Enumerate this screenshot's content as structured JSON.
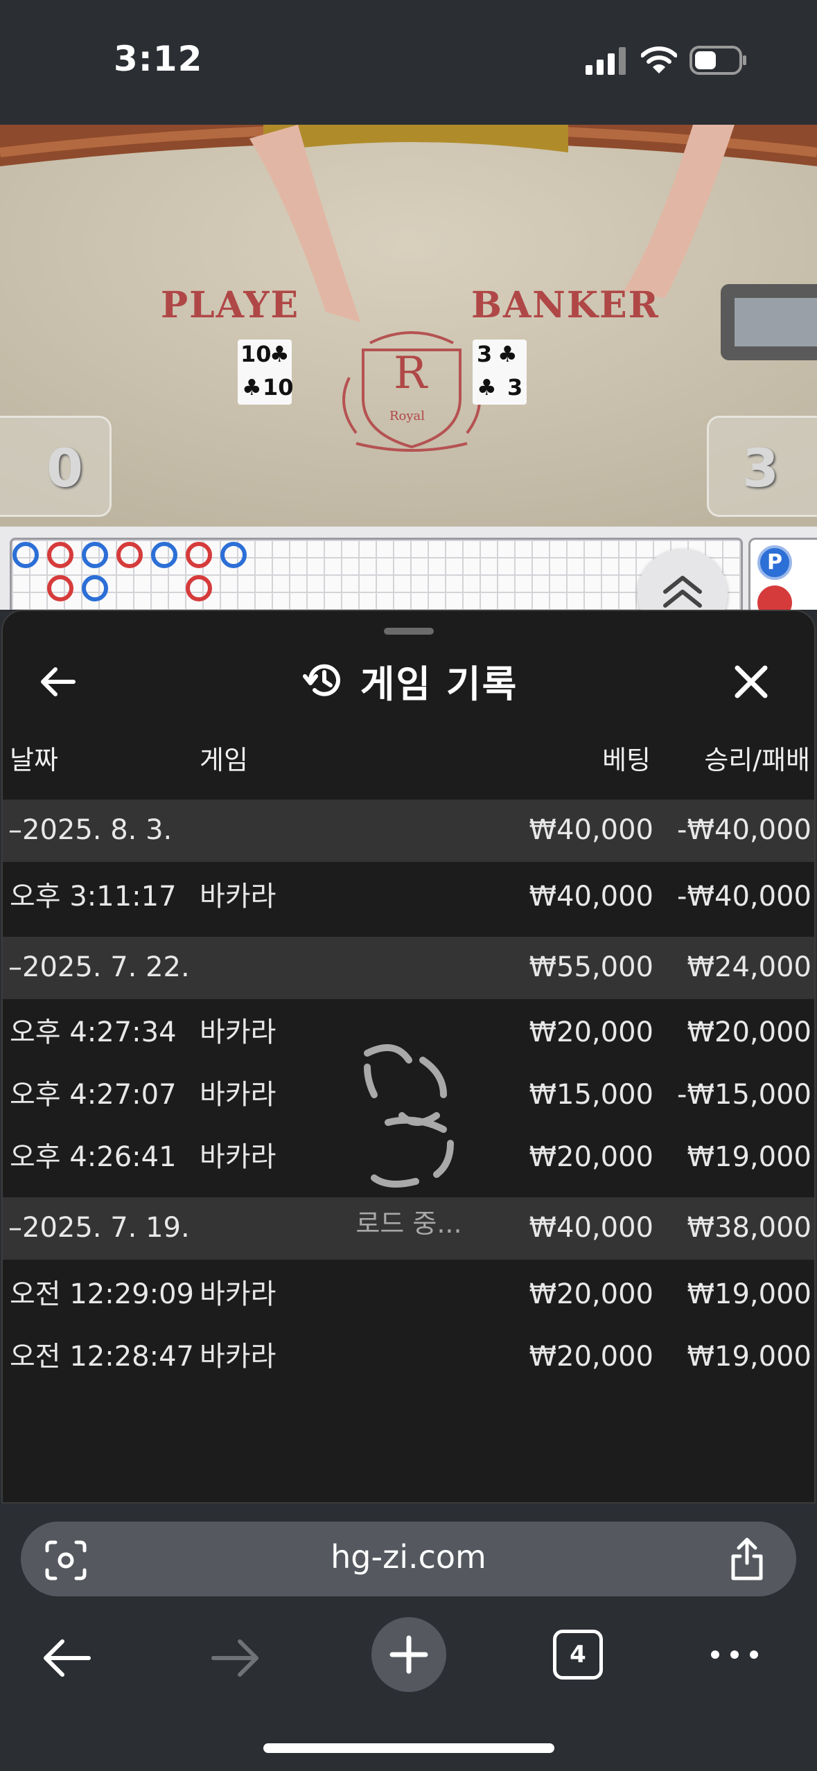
{
  "status_bar": {
    "time": "3:12"
  },
  "video": {
    "player_label": "PLAYE",
    "banker_label": "BANKER",
    "player_card_rank": "10",
    "player_card_suit": "♣",
    "banker_card_rank": "3",
    "banker_card_suit": "♣",
    "logo_letter": "R",
    "logo_text": "Royal",
    "player_score": "0",
    "banker_score": "3"
  },
  "roadmap": {
    "side_label": "P",
    "colors": {
      "player": "#2c6fd6",
      "banker": "#d63b3b"
    }
  },
  "history": {
    "title": "게임 기록",
    "headers": {
      "date": "날짜",
      "game": "게임",
      "bet": "베팅",
      "win_loss": "승리/패배"
    },
    "groups": [
      {
        "date": "–2025. 8. 3.",
        "bet": "₩40,000",
        "win_loss": "-₩40,000",
        "rows": [
          {
            "time": "오후 3:11:17",
            "game": "바카라",
            "bet": "₩40,000",
            "win_loss": "-₩40,000"
          }
        ]
      },
      {
        "date": "–2025. 7. 22.",
        "bet": "₩55,000",
        "win_loss": "₩24,000",
        "rows": [
          {
            "time": "오후 4:27:34",
            "game": "바카라",
            "bet": "₩20,000",
            "win_loss": "₩20,000"
          },
          {
            "time": "오후 4:27:07",
            "game": "바카라",
            "bet": "₩15,000",
            "win_loss": "-₩15,000"
          },
          {
            "time": "오후 4:26:41",
            "game": "바카라",
            "bet": "₩20,000",
            "win_loss": "₩19,000"
          }
        ]
      },
      {
        "date": "–2025. 7. 19.",
        "bet": "₩40,000",
        "win_loss": "₩38,000",
        "rows": [
          {
            "time": "오전 12:29:09",
            "game": "바카라",
            "bet": "₩20,000",
            "win_loss": "₩19,000"
          },
          {
            "time": "오전 12:28:47",
            "game": "바카라",
            "bet": "₩20,000",
            "win_loss": "₩19,000"
          }
        ]
      }
    ],
    "loading_text": "로드 중..."
  },
  "browser": {
    "url": "hg-zi.com",
    "tab_count": "4"
  }
}
